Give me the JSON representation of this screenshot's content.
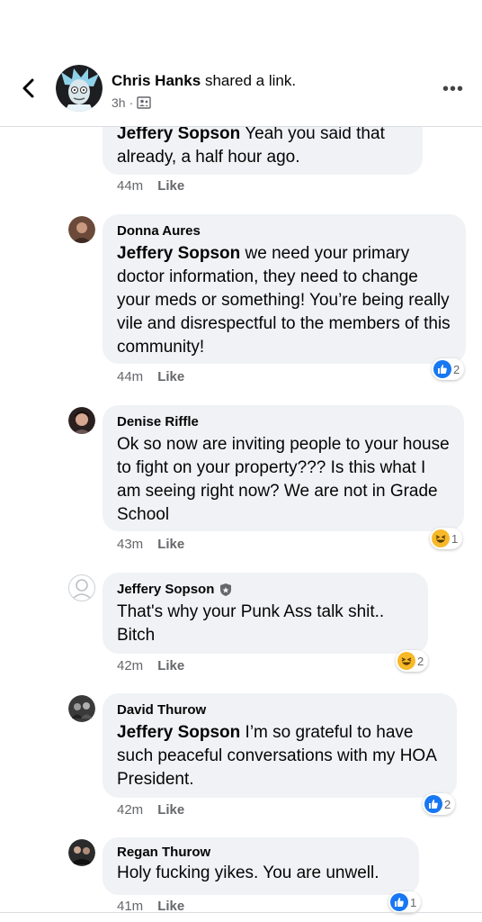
{
  "post": {
    "poster_name": "Chris Hanks",
    "action": "shared a link.",
    "time": "3h"
  },
  "comments": [
    {
      "author": "",
      "mention": "Jeffery Sopson",
      "text": " Yeah you said that already, a half hour ago.",
      "time": "44m",
      "like_label": "Like"
    },
    {
      "author": "Donna Aures",
      "mention": "Jeffery Sopson",
      "text": " we need your primary doctor information, they need to change your meds or something! You’re being really vile and disrespectful to the members of this community!",
      "time": "44m",
      "like_label": "Like",
      "reaction": {
        "type": "like",
        "count": "2"
      }
    },
    {
      "author": "Denise Riffle",
      "text": "Ok so now are inviting people to your house to fight on your property??? Is this what I am seeing right now? We are not in Grade School",
      "time": "43m",
      "like_label": "Like",
      "reaction": {
        "type": "haha",
        "count": "1"
      }
    },
    {
      "author": "Jeffery Sopson",
      "text": "That's why your Punk Ass talk shit.. Bitch",
      "time": "42m",
      "like_label": "Like",
      "reaction": {
        "type": "haha",
        "count": "2"
      }
    },
    {
      "author": "David Thurow",
      "mention": "Jeffery Sopson",
      "text": " I’m so grateful to have such peaceful conversations with my HOA President.",
      "time": "42m",
      "like_label": "Like",
      "reaction": {
        "type": "like",
        "count": "2"
      }
    },
    {
      "author": "Regan Thurow",
      "text": "Holy fucking yikes. You are unwell.",
      "time": "41m",
      "like_label": "Like",
      "reaction": {
        "type": "like",
        "count": "1"
      }
    }
  ],
  "colors": {
    "like_blue": "#1877f2",
    "haha_yellow": "#f7b928",
    "bubble_bg": "#f0f2f5",
    "meta_gray": "#65676b"
  }
}
